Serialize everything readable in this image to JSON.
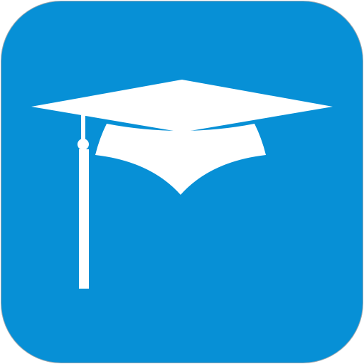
{
  "app_icon": {
    "icon": "graduation-cap-icon",
    "background_color": "#0790d6",
    "glyph_color": "#ffffff",
    "border_color": "#9aa6ae"
  }
}
